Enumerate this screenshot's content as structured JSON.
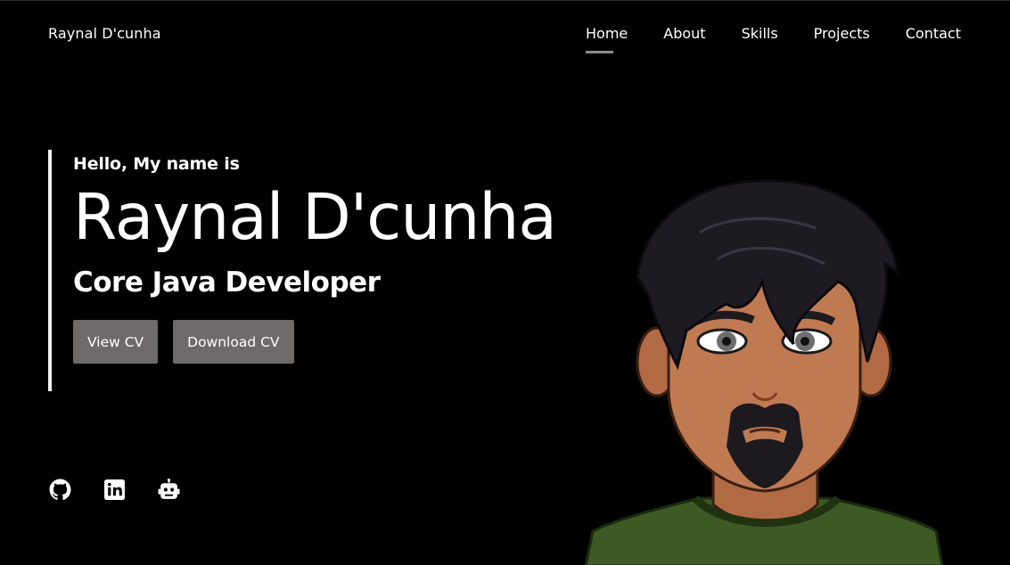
{
  "header": {
    "brand": "Raynal D'cunha",
    "nav": [
      {
        "label": "Home",
        "active": true
      },
      {
        "label": "About",
        "active": false
      },
      {
        "label": "Skills",
        "active": false
      },
      {
        "label": "Projects",
        "active": false
      },
      {
        "label": "Contact",
        "active": false
      }
    ]
  },
  "hero": {
    "greeting": "Hello, My name is",
    "name": "Raynal D'cunha",
    "role": "Core Java Developer",
    "buttons": {
      "view_cv": "View CV",
      "download_cv": "Download CV"
    }
  },
  "socials": [
    {
      "icon": "github-icon"
    },
    {
      "icon": "linkedin-icon"
    },
    {
      "icon": "robot-icon"
    }
  ],
  "colors": {
    "background": "#000000",
    "text": "#ffffff",
    "button": "#6f6a6a",
    "nav_underline": "#8a8a8a",
    "shirt": "#3d5a25"
  }
}
